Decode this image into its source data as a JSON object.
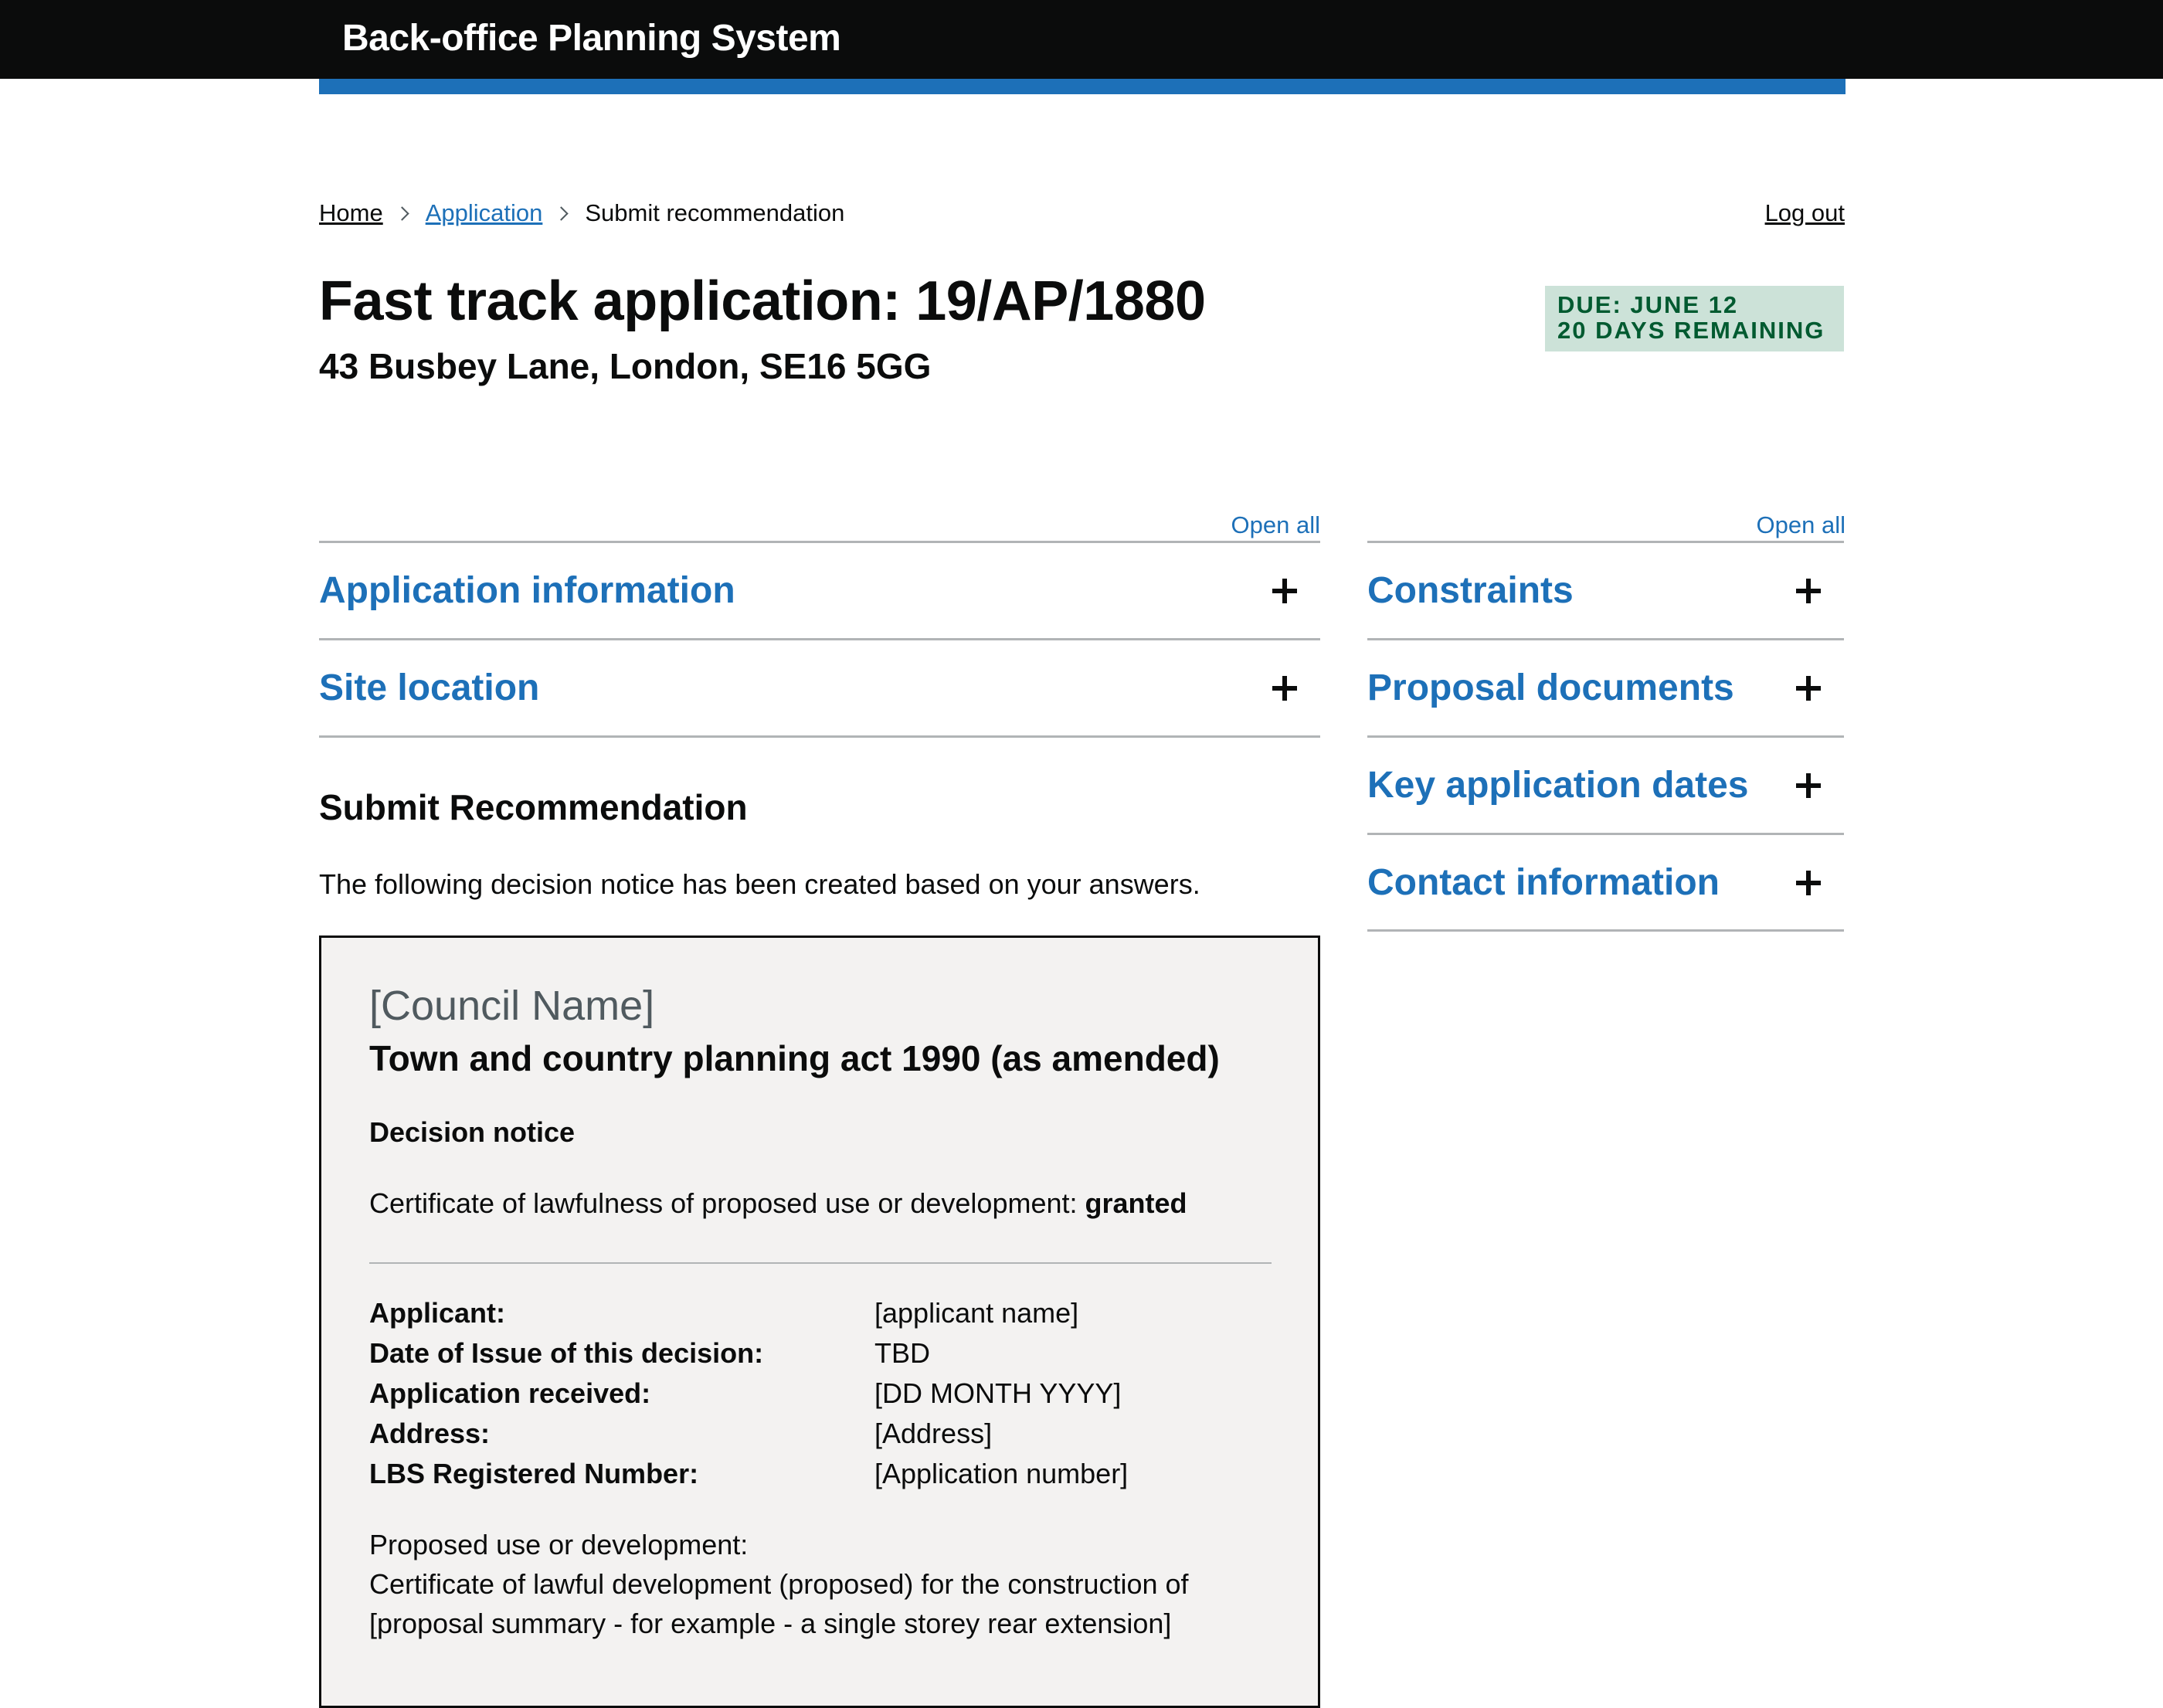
{
  "header": {
    "title": "Back-office Planning System",
    "accent_color": "#1d70b8"
  },
  "breadcrumb": {
    "home": "Home",
    "application": "Application",
    "current": "Submit recommendation"
  },
  "logout_label": "Log out",
  "page": {
    "title": "Fast track application: 19/AP/1880",
    "address": "43 Busbey Lane, London, SE16 5GG"
  },
  "due_tag": {
    "line1": "DUE: JUNE 12",
    "line2": "20 DAYS REMAINING",
    "color": "#cce2d8"
  },
  "left_accordion": {
    "open_all": "Open all",
    "sections": [
      {
        "title": "Application information",
        "icon": "plus-icon"
      },
      {
        "title": "Site location",
        "icon": "plus-icon"
      }
    ]
  },
  "right_accordion": {
    "open_all": "Open all",
    "sections": [
      {
        "title": "Constraints",
        "icon": "plus-icon"
      },
      {
        "title": "Proposal documents",
        "icon": "plus-icon"
      },
      {
        "title": "Key application dates",
        "icon": "plus-icon"
      },
      {
        "title": "Contact information",
        "icon": "plus-icon"
      }
    ]
  },
  "submit": {
    "heading": "Submit Recommendation",
    "intro": "The following decision notice has been created based on your answers."
  },
  "notice": {
    "council": "[Council Name]",
    "act": "Town and country planning act 1990 (as amended)",
    "decision_label": "Decision notice",
    "certificate_text": "Certificate of lawfulness of proposed use or development: ",
    "certificate_status": "granted",
    "details": [
      {
        "key": "Applicant:",
        "value": "[applicant name]"
      },
      {
        "key": "Date of Issue of this decision:",
        "value": "TBD"
      },
      {
        "key": "Application received:",
        "value": "[DD MONTH YYYY]"
      },
      {
        "key": "Address:",
        "value": "[Address]"
      },
      {
        "key": "LBS Registered Number:",
        "value": "[Application number]"
      }
    ],
    "proposed_label": "Proposed use or development:",
    "proposed_line1": "Certificate of lawful development (proposed) for the construction of",
    "proposed_line2": "[proposal summary - for example - a single storey rear extension]"
  }
}
